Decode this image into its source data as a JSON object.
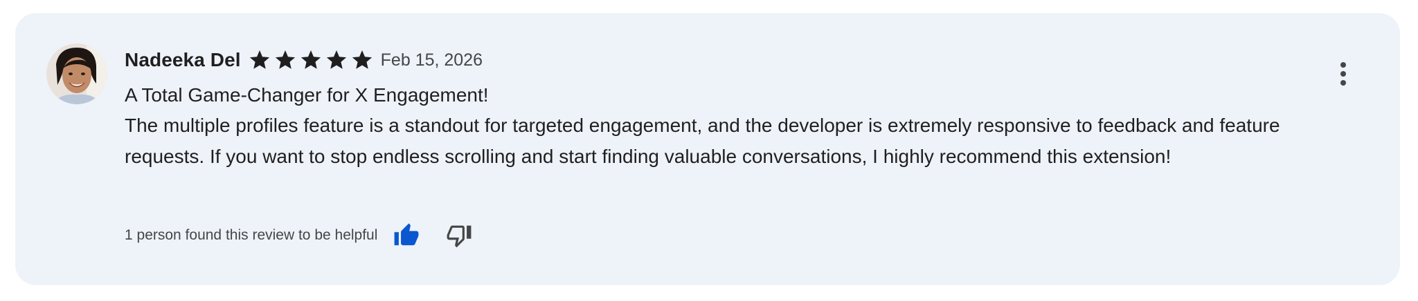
{
  "review": {
    "author": "Nadeeka Del",
    "rating": 5,
    "rating_max": 5,
    "date": "Feb 15, 2026",
    "title": "A Total Game-Changer for X Engagement!",
    "body": "The multiple profiles feature is a standout for targeted engagement, and the developer is extremely responsive to feedback and feature requests. If you want to stop endless scrolling and start finding valuable conversations, I highly recommend this extension!",
    "helpful_text": "1 person found this review to be helpful",
    "thumbs_up_selected": true
  },
  "icons": {
    "avatar": "user-photo-avatar",
    "star": "star-filled-icon",
    "more": "more-vertical-icon",
    "thumbs_up": "thumbs-up-filled-icon",
    "thumbs_down": "thumbs-down-outline-icon"
  },
  "colors": {
    "card_background": "#eef2f9",
    "text_primary": "#1f1f1f",
    "text_secondary": "#444746",
    "star": "#1f1f1f",
    "accent_blue": "#0b57d0"
  }
}
